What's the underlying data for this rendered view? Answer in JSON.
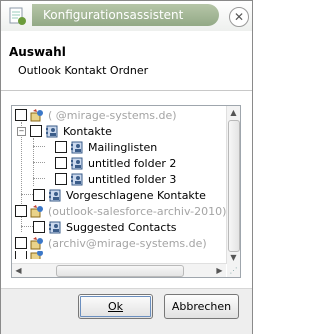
{
  "window": {
    "title": "Konfigurationsassistent",
    "close_glyph": "✕"
  },
  "header": {
    "title": "Auswahl",
    "subtitle": "Outlook Kontakt Ordner"
  },
  "tree": {
    "rows": [
      {
        "label": "(                    @mirage-systems.de)",
        "style": "gray",
        "icon": "pst-store-icon"
      },
      {
        "label": "Kontakte",
        "style": "normal",
        "icon": "contacts-folder-icon"
      },
      {
        "label": "Mailinglisten",
        "style": "normal",
        "icon": "contacts-folder-icon"
      },
      {
        "label": "untitled folder 2",
        "style": "normal",
        "icon": "contacts-folder-icon"
      },
      {
        "label": "untitled folder 3",
        "style": "normal",
        "icon": "contacts-folder-icon"
      },
      {
        "label": "Vorgeschlagene Kontakte",
        "style": "normal",
        "icon": "contacts-folder-icon"
      },
      {
        "label": "(outlook-salesforce-archiv-2010)",
        "style": "gray",
        "icon": "pst-store-icon"
      },
      {
        "label": "Suggested Contacts",
        "style": "normal",
        "icon": "contacts-folder-icon"
      },
      {
        "label": "(archiv@mirage-systems.de)",
        "style": "gray",
        "icon": "pst-store-icon"
      }
    ],
    "expander_minus": "−"
  },
  "scroll": {
    "up": "▲",
    "down": "▼",
    "left": "◀",
    "right": "▶",
    "grip": "⋰"
  },
  "buttons": {
    "ok": "Ok",
    "cancel": "Abbrechen"
  }
}
